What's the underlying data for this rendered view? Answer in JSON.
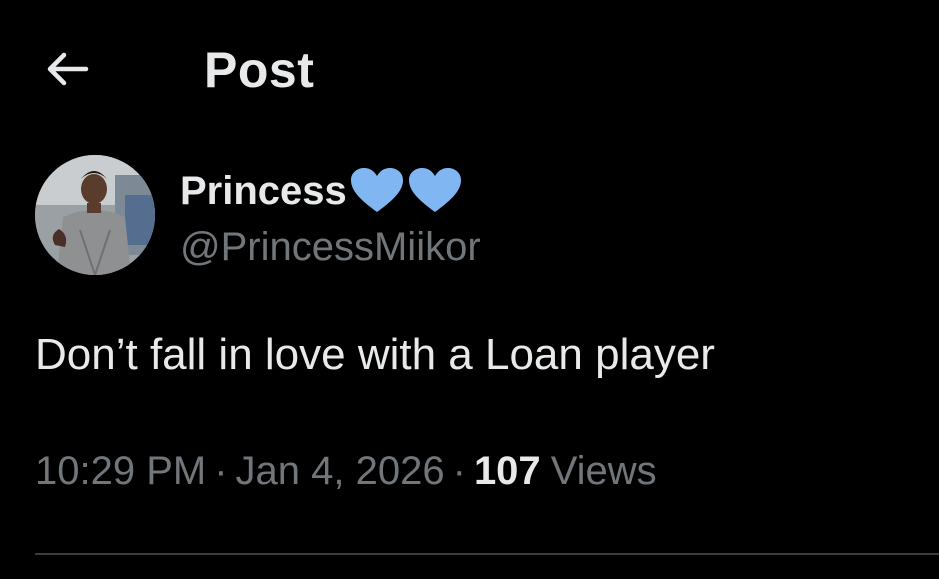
{
  "header": {
    "title": "Post",
    "back_icon": "arrow-left-icon"
  },
  "author": {
    "display_name": "Princess",
    "name_emojis": [
      "blue-heart-icon",
      "blue-heart-icon"
    ],
    "handle": "@PrincessMiikor",
    "avatar": "profile-photo"
  },
  "post": {
    "text": "Don’t fall in love with a Loan player"
  },
  "meta": {
    "time": "10:29 PM",
    "separator": "·",
    "date": "Jan 4, 2026",
    "views_count": "107",
    "views_label": "Views"
  },
  "colors": {
    "background": "#000000",
    "primary_text": "#e7e9ea",
    "secondary_text": "#71767b",
    "heart": "#80b7f3",
    "divider": "#3a3d40"
  }
}
